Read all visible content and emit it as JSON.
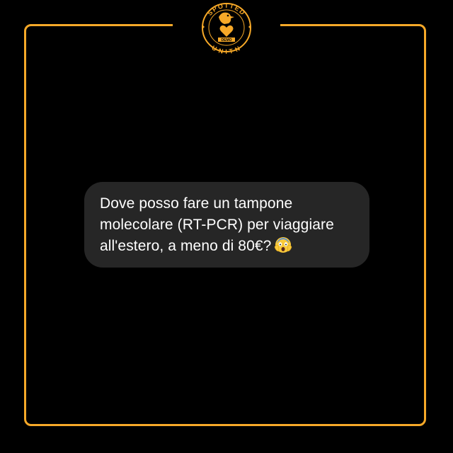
{
  "logo": {
    "top_text": "SPOTTED",
    "bottom_text": "UNITN",
    "ribbon_text": "DEMO",
    "accent_color": "#f7a928"
  },
  "frame": {
    "border_color": "#f7a928"
  },
  "message": {
    "lines": [
      "Dove posso fare un tampone",
      "molecolare (RT-PCR) per viaggiare",
      "all'estero, a meno di 80€?"
    ],
    "emoji": "screaming-face-icon",
    "bubble_color": "#262626"
  }
}
